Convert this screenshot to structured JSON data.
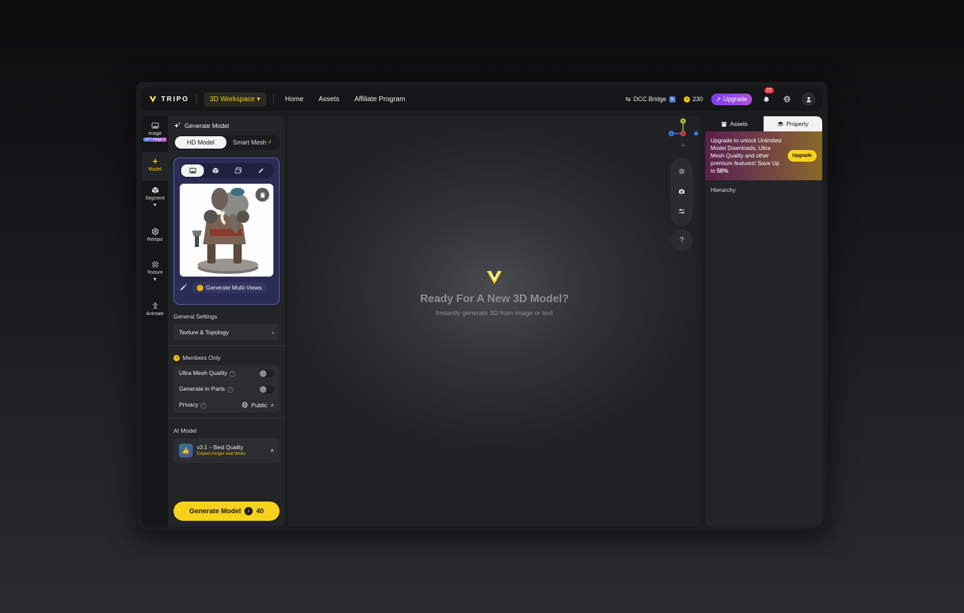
{
  "topbar": {
    "brand": "TRIPO",
    "workspace": "3D Workspace",
    "nav": [
      "Home",
      "Assets",
      "Affiliate Program"
    ],
    "dcc_bridge": "DCC Bridge",
    "credits": "230",
    "upgrade": "Upgrade",
    "notifications": "22"
  },
  "rail": {
    "items": [
      {
        "label": "Image",
        "tag": "GPT Image 2"
      },
      {
        "label": "Model"
      },
      {
        "label": "Segment"
      },
      {
        "label": "Retopo"
      },
      {
        "label": "Texture"
      },
      {
        "label": "Animate"
      }
    ]
  },
  "panel": {
    "title": "Generate Model",
    "tabs": [
      "HD Model",
      "Smart Mesh"
    ],
    "generate_multiviews": "Generate Multi-Views",
    "general_settings": "General Settings",
    "texture_topology": "Texture & Topology",
    "members_only": "Members Only",
    "ultra_mesh": "Ultra Mesh Quality",
    "generate_parts": "Generate in Parts",
    "privacy": "Privacy",
    "privacy_value": "Public",
    "ai_model_label": "AI Model",
    "ai_model_name": "v3.1 – Best Quality",
    "ai_model_sub": "Expect longer wait times",
    "generate_button": "Generate Model",
    "generate_cost": "40"
  },
  "viewport": {
    "title": "Ready For A New 3D Model?",
    "subtitle": "Instantly generate 3D from image or text",
    "help": "?"
  },
  "right": {
    "tabs": [
      "Assets",
      "Property"
    ],
    "upsell_line1": "Upgrade to unlock Unlimited Model Downloads, Ultra Mesh Quality and other premium features!  Save Up to ",
    "upsell_percent": "50%",
    "upsell_button": "Upgrade",
    "hierarchy": "Hierarchy"
  },
  "colors": {
    "accent": "#f7d21c",
    "upload_card": "#2b2c55",
    "upgrade_pill": "#8a45e6"
  }
}
